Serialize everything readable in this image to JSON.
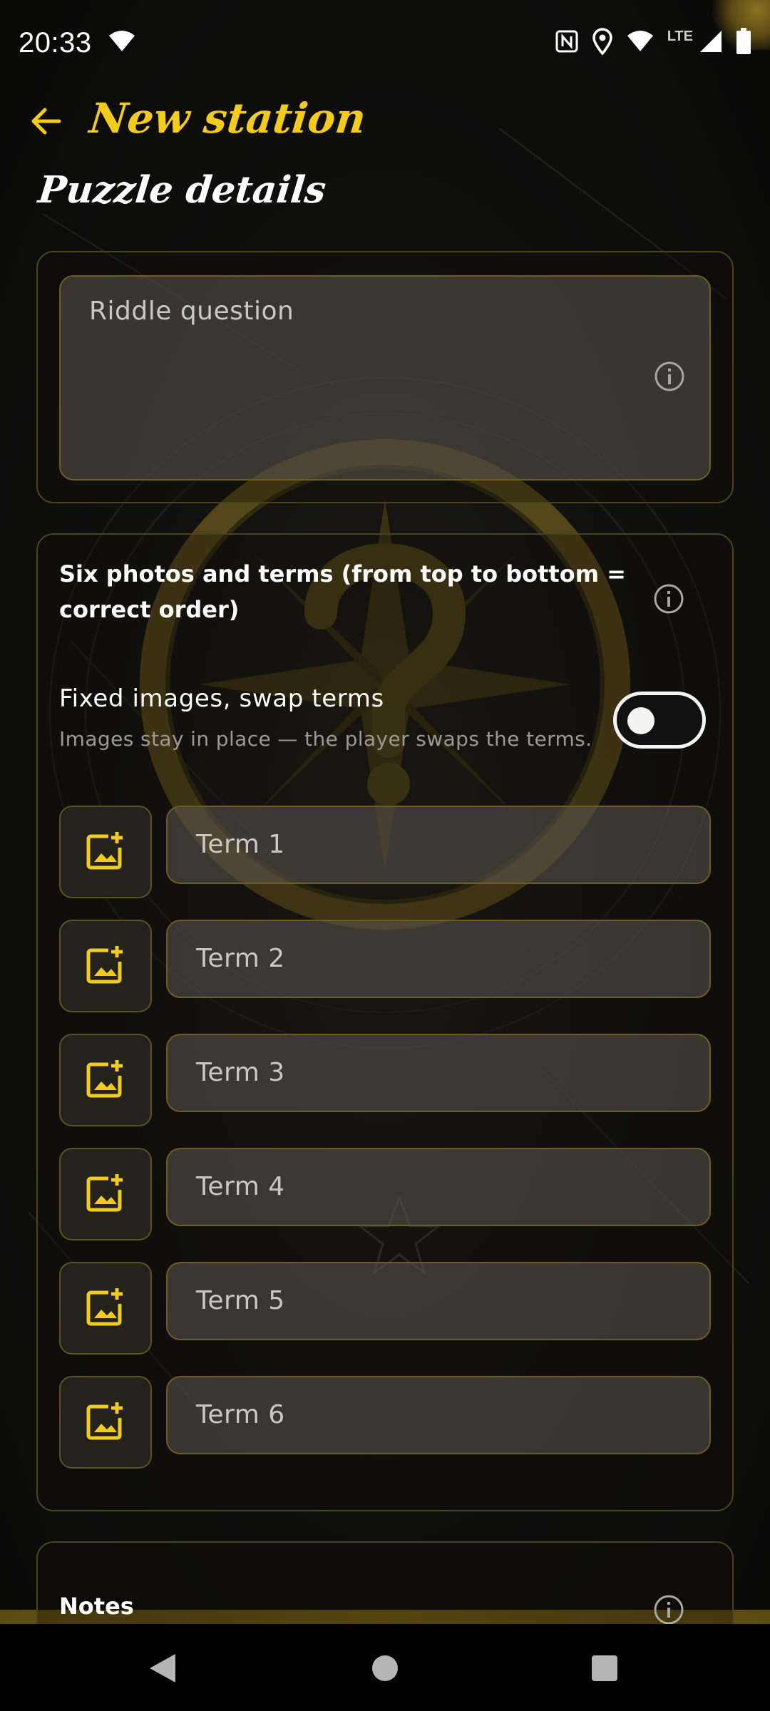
{
  "status_bar": {
    "time": "20:33",
    "network_type": "LTE",
    "icons": [
      "wifi-icon",
      "nfc-icon",
      "location-icon",
      "wifi-icon",
      "signal-icon",
      "battery-icon"
    ]
  },
  "app_bar": {
    "title": "New station",
    "back_icon": "arrow-back-icon"
  },
  "section_title": "Puzzle details",
  "riddle": {
    "placeholder": "Riddle question"
  },
  "terms_card": {
    "heading": "Six photos and terms (from top to bottom = correct order)",
    "toggle_label": "Fixed images, swap terms",
    "toggle_subtitle": "Images stay in place — the player swaps the terms.",
    "toggle_on": false,
    "terms": [
      {
        "placeholder": "Term 1"
      },
      {
        "placeholder": "Term 2"
      },
      {
        "placeholder": "Term 3"
      },
      {
        "placeholder": "Term 4"
      },
      {
        "placeholder": "Term 5"
      },
      {
        "placeholder": "Term 6"
      }
    ]
  },
  "notes_card": {
    "label": "Notes"
  },
  "colors": {
    "accent": "#f2cb1d",
    "border": "#4a4218",
    "background": "#0c0c0a"
  }
}
